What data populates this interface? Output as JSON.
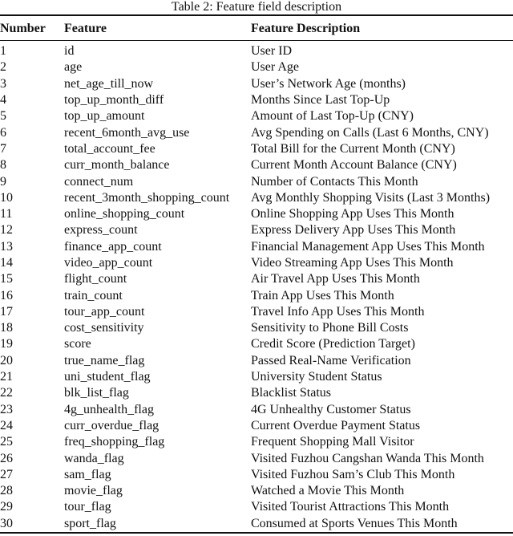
{
  "caption": "Table 2: Feature field description",
  "table": {
    "headers": [
      "Number",
      "Feature",
      "Feature Description"
    ],
    "rows": [
      {
        "number": "1",
        "feature": "id",
        "description": "User ID"
      },
      {
        "number": "2",
        "feature": "age",
        "description": "User Age"
      },
      {
        "number": "3",
        "feature": "net_age_till_now",
        "description": "User’s Network Age (months)"
      },
      {
        "number": "4",
        "feature": "top_up_month_diff",
        "description": "Months Since Last Top-Up"
      },
      {
        "number": "5",
        "feature": "top_up_amount",
        "description": "Amount of Last Top-Up (CNY)"
      },
      {
        "number": "6",
        "feature": "recent_6month_avg_use",
        "description": "Avg Spending on Calls (Last 6 Months, CNY)"
      },
      {
        "number": "7",
        "feature": "total_account_fee",
        "description": "Total Bill for the Current Month (CNY)"
      },
      {
        "number": "8",
        "feature": "curr_month_balance",
        "description": "Current Month Account Balance (CNY)"
      },
      {
        "number": "9",
        "feature": "connect_num",
        "description": "Number of Contacts This Month"
      },
      {
        "number": "10",
        "feature": "recent_3month_shopping_count",
        "description": "Avg Monthly Shopping Visits (Last 3 Months)"
      },
      {
        "number": "11",
        "feature": "online_shopping_count",
        "description": "Online Shopping App Uses This Month"
      },
      {
        "number": "12",
        "feature": "express_count",
        "description": "Express Delivery App Uses This Month"
      },
      {
        "number": "13",
        "feature": "finance_app_count",
        "description": "Financial Management App Uses This Month"
      },
      {
        "number": "14",
        "feature": "video_app_count",
        "description": "Video Streaming App Uses This Month"
      },
      {
        "number": "15",
        "feature": "flight_count",
        "description": "Air Travel App Uses This Month"
      },
      {
        "number": "16",
        "feature": "train_count",
        "description": "Train App Uses This Month"
      },
      {
        "number": "17",
        "feature": "tour_app_count",
        "description": "Travel Info App Uses This Month"
      },
      {
        "number": "18",
        "feature": "cost_sensitivity",
        "description": "Sensitivity to Phone Bill Costs"
      },
      {
        "number": "19",
        "feature": "score",
        "description": "Credit Score (Prediction Target)"
      },
      {
        "number": "20",
        "feature": "true_name_flag",
        "description": "Passed Real-Name Verification"
      },
      {
        "number": "21",
        "feature": "uni_student_flag",
        "description": "University Student Status"
      },
      {
        "number": "22",
        "feature": "blk_list_flag",
        "description": "Blacklist Status"
      },
      {
        "number": "23",
        "feature": "4g_unhealth_flag",
        "description": "4G Unhealthy Customer Status"
      },
      {
        "number": "24",
        "feature": "curr_overdue_flag",
        "description": "Current Overdue Payment Status"
      },
      {
        "number": "25",
        "feature": "freq_shopping_flag",
        "description": "Frequent Shopping Mall Visitor"
      },
      {
        "number": "26",
        "feature": "wanda_flag",
        "description": "Visited Fuzhou Cangshan Wanda This Month"
      },
      {
        "number": "27",
        "feature": "sam_flag",
        "description": "Visited Fuzhou Sam’s Club This Month"
      },
      {
        "number": "28",
        "feature": "movie_flag",
        "description": "Watched a Movie This Month"
      },
      {
        "number": "29",
        "feature": "tour_flag",
        "description": "Visited Tourist Attractions This Month"
      },
      {
        "number": "30",
        "feature": "sport_flag",
        "description": "Consumed at Sports Venues This Month"
      }
    ]
  }
}
